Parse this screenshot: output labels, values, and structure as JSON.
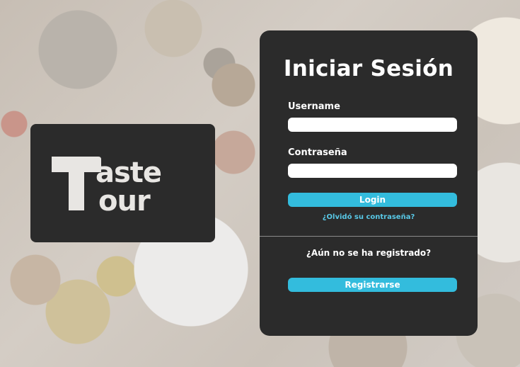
{
  "brand": {
    "logo_line1": "aste",
    "logo_line2": "our",
    "logo_initial": "T"
  },
  "login": {
    "title": "Iniciar Sesión",
    "username_label": "Username",
    "username_value": "",
    "password_label": "Contraseña",
    "password_value": "",
    "login_button": "Login",
    "forgot_link": "¿Olvidó su contraseña?",
    "register_question": "¿Aún no se ha registrado?",
    "register_button": "Registrarse"
  },
  "colors": {
    "card": "#2b2b2b",
    "accent": "#33bcdd",
    "link": "#58c8e6"
  }
}
